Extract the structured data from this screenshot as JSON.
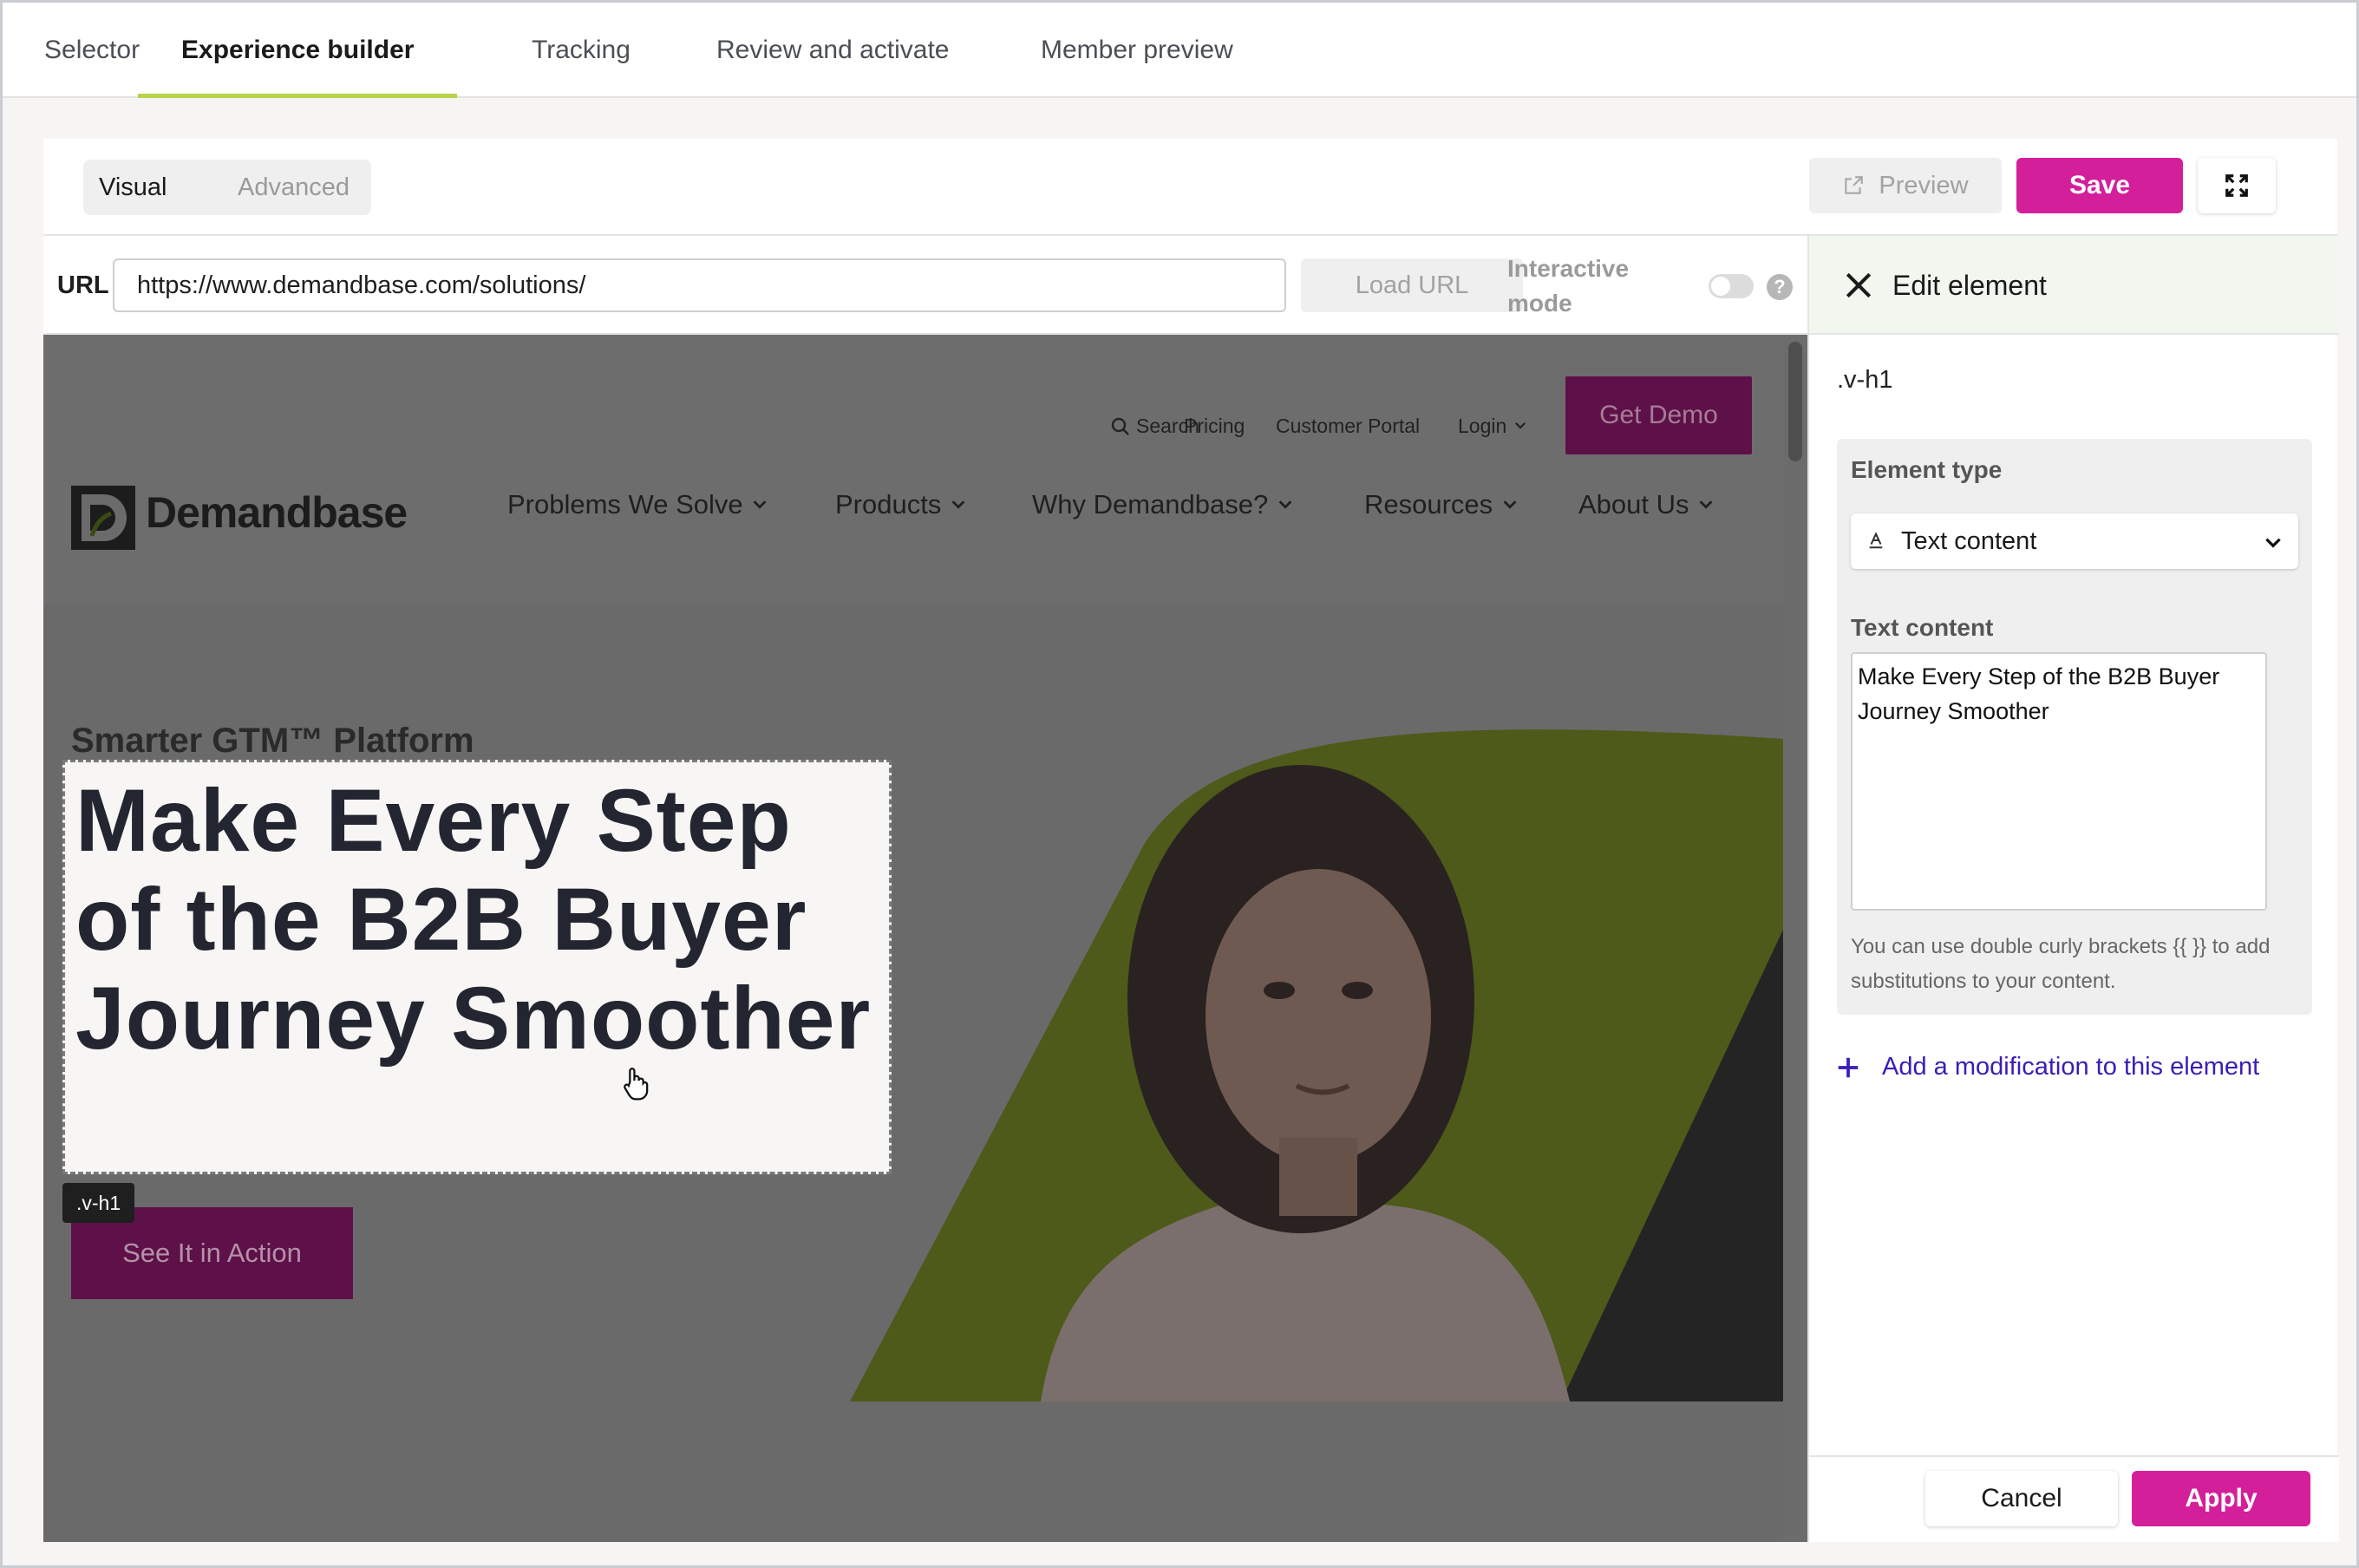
{
  "tabs": [
    {
      "label": "Selector",
      "active": false
    },
    {
      "label": "Experience builder",
      "active": true
    },
    {
      "label": "Tracking",
      "active": false
    },
    {
      "label": "Review and activate",
      "active": false
    },
    {
      "label": "Member preview",
      "active": false
    }
  ],
  "toolbar": {
    "mode_visual": "Visual",
    "mode_advanced": "Advanced",
    "preview_label": "Preview",
    "save_label": "Save"
  },
  "urlbar": {
    "label": "URL",
    "value": "https://www.demandbase.com/solutions/",
    "load_label": "Load URL",
    "interactive_label_1": "Interactive",
    "interactive_label_2": "mode",
    "interactive_on": false
  },
  "site": {
    "util_links": [
      "Search",
      "Pricing",
      "Customer Portal",
      "Login"
    ],
    "cta": "Get Demo",
    "logo": "Demandbase",
    "nav": [
      "Problems We Solve",
      "Products",
      "Why Demandbase?",
      "Resources",
      "About Us"
    ],
    "eyebrow": "Smarter GTM™ Platform",
    "headline": "Make Every Step of the B2B Buyer Journey Smoother",
    "selected_tag": ".v-h1",
    "hero_button": "See It in Action"
  },
  "panel": {
    "title": "Edit element",
    "selector": ".v-h1",
    "element_type_label": "Element type",
    "element_type_value": "Text content",
    "text_content_label": "Text content",
    "text_content_value": "Make Every Step of the B2B Buyer Journey Smoother",
    "hint": "You can use double curly brackets {{ }} to add substitutions to your content.",
    "add_modification": "Add a modification to this element",
    "cancel_label": "Cancel",
    "apply_label": "Apply"
  },
  "colors": {
    "brand_magenta": "#d41f9a",
    "active_tab_underline": "#b7d34a",
    "link_purple": "#3a1db8",
    "hero_lime": "#6f8a1a"
  }
}
